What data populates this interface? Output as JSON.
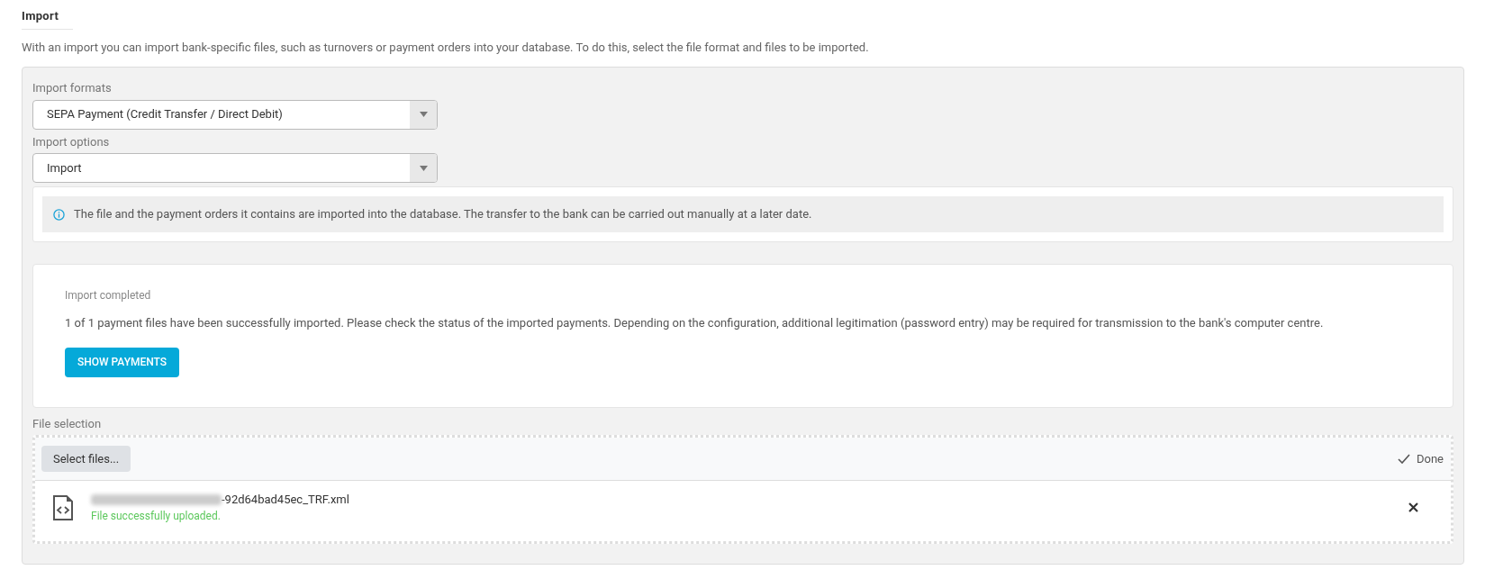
{
  "title": "Import",
  "description": "With an import you can import bank-specific files, such as turnovers or payment orders into your database. To do this, select the file format and files to be imported.",
  "fields": [
    {
      "label": "Import formats",
      "value": "SEPA Payment (Credit Transfer / Direct Debit)"
    },
    {
      "label": "Import options",
      "value": "Import"
    }
  ],
  "info": "The file and the payment orders it contains are imported into the database. The transfer to the bank can be carried out manually at a later date.",
  "result": {
    "title": "Import completed",
    "message": "1 of 1 payment files have been successfully imported. Please check the status of the imported payments. Depending on the configuration, additional legitimation (password entry) may be required for transmission to the bank's computer centre.",
    "button": "SHOW PAYMENTS"
  },
  "file_selection": {
    "label": "File selection",
    "button": "Select files...",
    "status": "Done",
    "files": [
      {
        "name": "-92d64bad45ec_TRF.xml",
        "status": "File successfully uploaded."
      }
    ]
  }
}
